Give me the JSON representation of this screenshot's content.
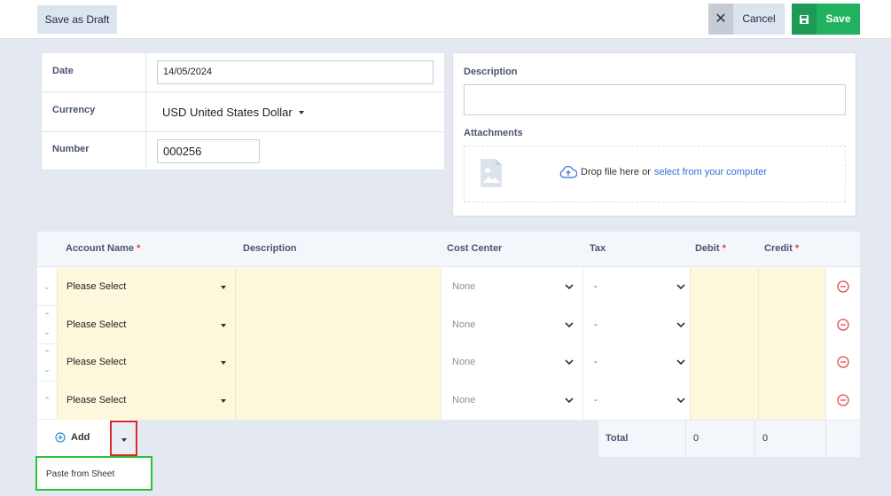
{
  "toolbar": {
    "draft_label": "Save as Draft",
    "cancel_label": "Cancel",
    "save_label": "Save"
  },
  "form": {
    "date_label": "Date",
    "date_value": "14/05/2024",
    "currency_label": "Currency",
    "currency_value": "USD United States Dollar",
    "number_label": "Number",
    "number_value": "000256"
  },
  "side": {
    "description_label": "Description",
    "attachments_label": "Attachments",
    "drop_text": "Drop file here or",
    "drop_link": "select from your computer"
  },
  "table": {
    "headers": {
      "account": "Account Name",
      "description": "Description",
      "cost_center": "Cost Center",
      "tax": "Tax",
      "debit": "Debit",
      "credit": "Credit"
    },
    "required_mark": "*",
    "rows": [
      {
        "account": "Please Select",
        "cost_center": "None",
        "tax": "-"
      },
      {
        "account": "Please Select",
        "cost_center": "None",
        "tax": "-"
      },
      {
        "account": "Please Select",
        "cost_center": "None",
        "tax": "-"
      },
      {
        "account": "Please Select",
        "cost_center": "None",
        "tax": "-"
      }
    ]
  },
  "footer": {
    "add_label": "Add",
    "menu_item": "Paste from Sheet",
    "total_label": "Total",
    "total_debit": "0",
    "total_credit": "0"
  },
  "colors": {
    "save_green": "#22b15f",
    "highlight_red": "#d62b2b",
    "highlight_green": "#2bc23b",
    "delete_red": "#e5484d",
    "link_blue": "#2d6fd6"
  }
}
